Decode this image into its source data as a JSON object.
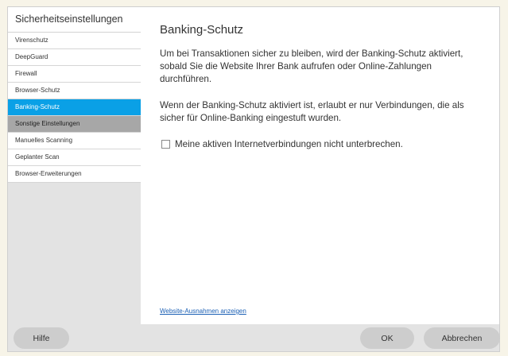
{
  "sidebar": {
    "title": "Sicherheitseinstellungen",
    "items": [
      {
        "label": "Virenschutz"
      },
      {
        "label": "DeepGuard"
      },
      {
        "label": "Firewall"
      },
      {
        "label": "Browser-Schutz"
      },
      {
        "label": "Banking-Schutz",
        "state": "selected"
      },
      {
        "label": "Sonstige Einstellungen"
      },
      {
        "label": "Manuelles Scanning"
      },
      {
        "label": "Geplanter Scan"
      },
      {
        "label": "Browser-Erweiterungen"
      }
    ]
  },
  "content": {
    "title": "Banking-Schutz",
    "paragraph1": "Um bei Transaktionen sicher zu bleiben, wird der Banking-Schutz aktiviert, sobald Sie die Website Ihrer Bank aufrufen oder Online-Zahlungen durchführen.",
    "paragraph2": "Wenn der Banking-Schutz aktiviert ist, erlaubt er nur Verbindungen, die als sicher für Online-Banking eingestuft wurden.",
    "checkbox_label": "Meine aktiven Internetverbindungen nicht unterbrechen.",
    "checkbox_checked": false,
    "link": "Website-Ausnahmen anzeigen"
  },
  "footer": {
    "help_label": "Hilfe",
    "ok_label": "OK",
    "cancel_label": "Abbrechen"
  },
  "colors": {
    "accent": "#0aa0e6",
    "page_background": "#f7f4e8",
    "panel_grey": "#e3e3e3"
  }
}
